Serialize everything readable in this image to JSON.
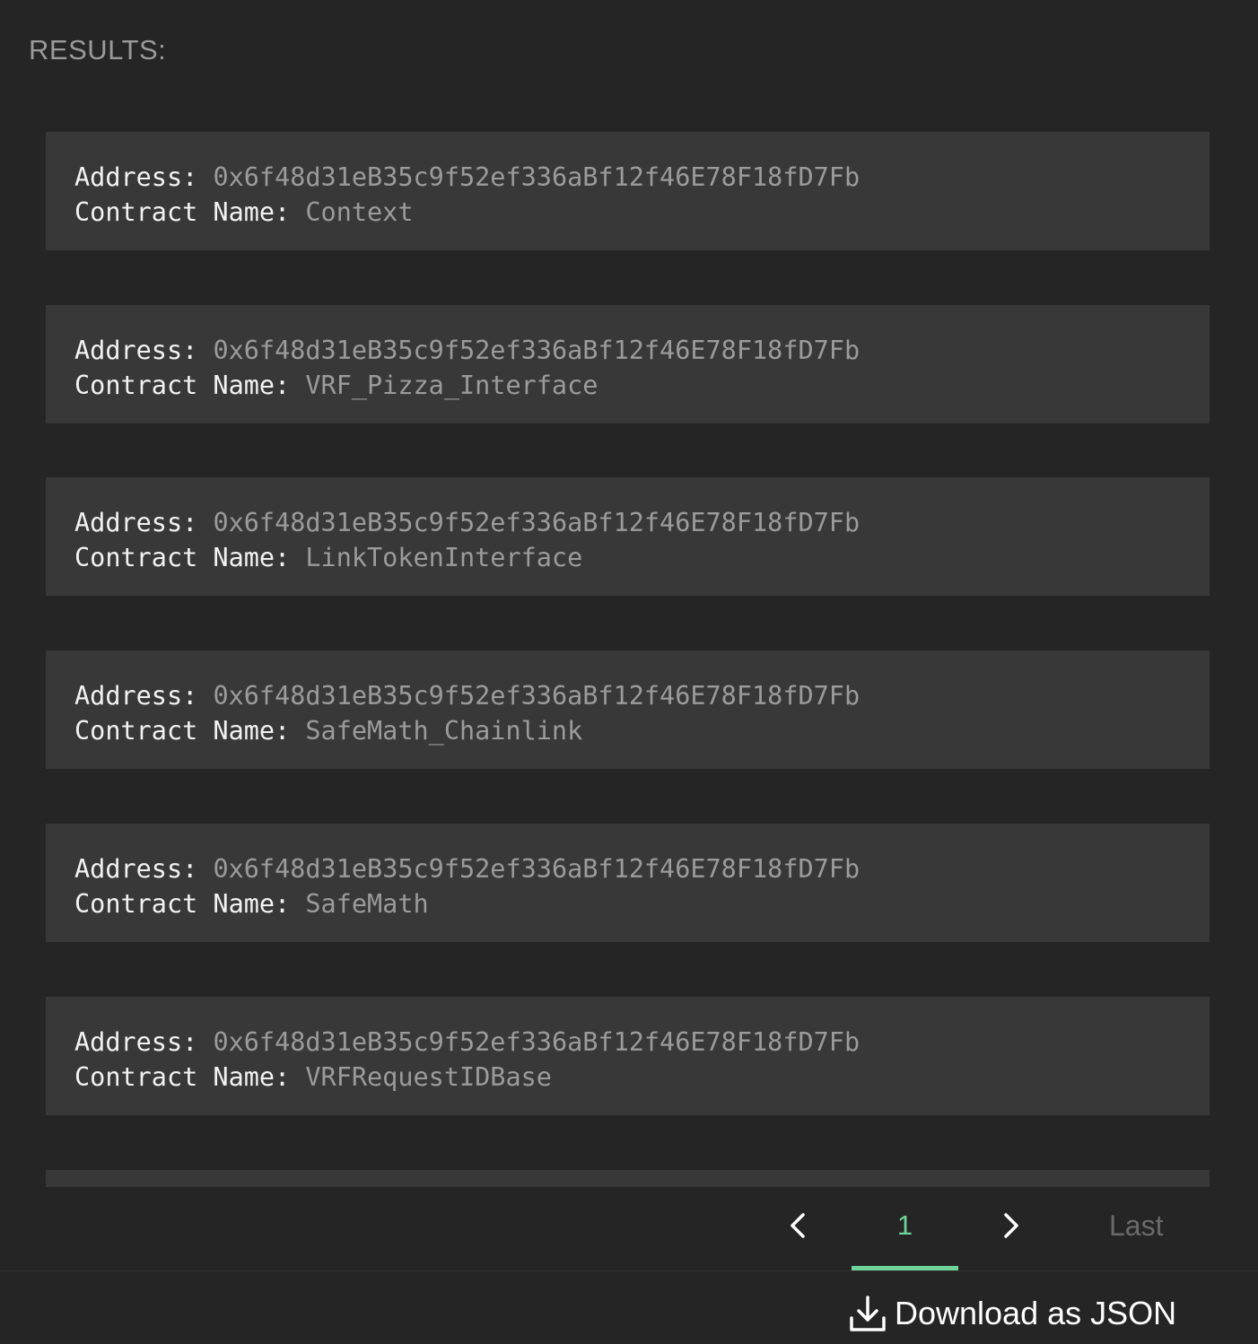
{
  "results_heading": "RESULTS:",
  "field_labels": {
    "address": "Address:",
    "contract_name": "Contract Name:"
  },
  "results": [
    {
      "address": "0x6f48d31eB35c9f52ef336aBf12f46E78F18fD7Fb",
      "contract_name": "Context"
    },
    {
      "address": "0x6f48d31eB35c9f52ef336aBf12f46E78F18fD7Fb",
      "contract_name": "VRF_Pizza_Interface"
    },
    {
      "address": "0x6f48d31eB35c9f52ef336aBf12f46E78F18fD7Fb",
      "contract_name": "LinkTokenInterface"
    },
    {
      "address": "0x6f48d31eB35c9f52ef336aBf12f46E78F18fD7Fb",
      "contract_name": "SafeMath_Chainlink"
    },
    {
      "address": "0x6f48d31eB35c9f52ef336aBf12f46E78F18fD7Fb",
      "contract_name": "SafeMath"
    },
    {
      "address": "0x6f48d31eB35c9f52ef336aBf12f46E78F18fD7Fb",
      "contract_name": "VRFRequestIDBase"
    }
  ],
  "pagination": {
    "prev_icon": "chevron-left-icon",
    "current_page": "1",
    "next_icon": "chevron-right-icon",
    "last_label": "Last"
  },
  "download": {
    "icon": "download-icon",
    "label": "Download as JSON"
  },
  "colors": {
    "background": "#252525",
    "card": "#383838",
    "accent": "#6fd49a",
    "label_text": "#f2f2f2",
    "value_text": "#9b9b9b"
  }
}
